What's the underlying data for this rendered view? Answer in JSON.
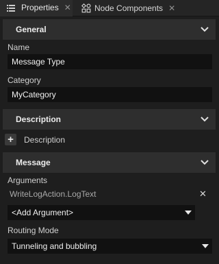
{
  "tabs": [
    {
      "label": "Properties",
      "icon": "list-icon",
      "active": true
    },
    {
      "label": "Node Components",
      "icon": "node-components-icon",
      "active": false
    }
  ],
  "sections": {
    "general": {
      "title": "General",
      "name_label": "Name",
      "name_value": "Message Type",
      "category_label": "Category",
      "category_value": "MyCategory"
    },
    "description": {
      "title": "Description",
      "add_label": "+",
      "item_label": "Description"
    },
    "message": {
      "title": "Message",
      "arguments_label": "Arguments",
      "arguments": [
        "WriteLogAction.LogText"
      ],
      "remove_glyph": "✕",
      "add_argument_value": "<Add Argument>",
      "routing_mode_label": "Routing Mode",
      "routing_mode_value": "Tunneling and bubbling"
    }
  },
  "colors": {
    "background": "#1e1e1e",
    "section_header": "#2e2e2e",
    "field": "#111111",
    "text": "#d8d8d8"
  }
}
